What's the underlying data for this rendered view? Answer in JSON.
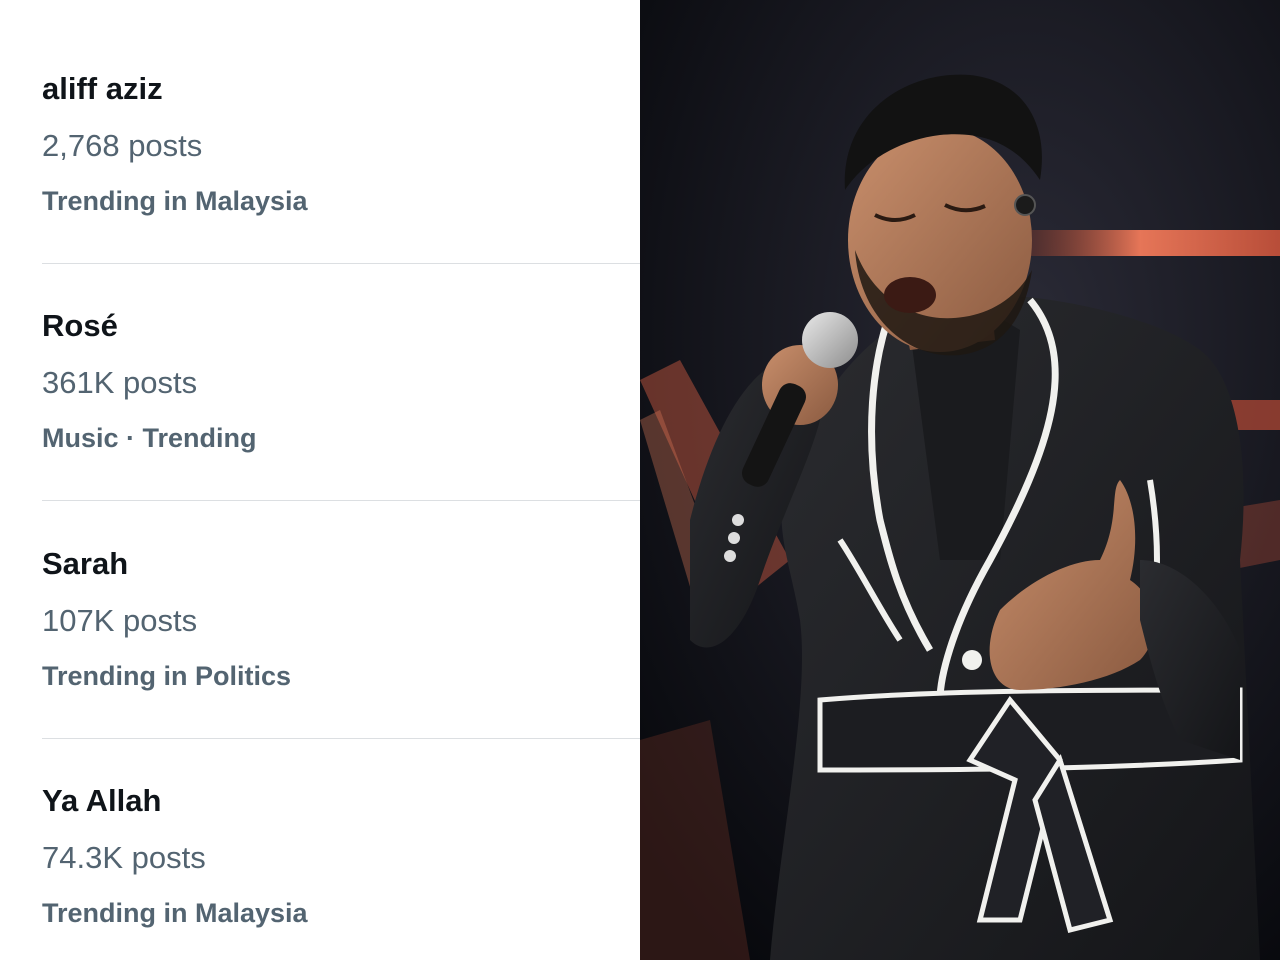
{
  "trends": [
    {
      "topic": "aliff aziz",
      "posts": "2,768 posts",
      "context": "Trending in Malaysia"
    },
    {
      "topic": "Rosé",
      "posts": "361K posts",
      "context": "Music · Trending"
    },
    {
      "topic": "Sarah",
      "posts": "107K posts",
      "context": "Trending in Politics"
    },
    {
      "topic": "Ya Allah",
      "posts": "74.3K posts",
      "context": "Trending in Malaysia"
    }
  ],
  "colors": {
    "topic": "#0f1419",
    "secondary": "#536471",
    "divider": "#dcdfe2",
    "stage_light": "#e8694a"
  },
  "photo": {
    "subject": "male singer in black suit with white piping singing into a microphone on stage"
  }
}
